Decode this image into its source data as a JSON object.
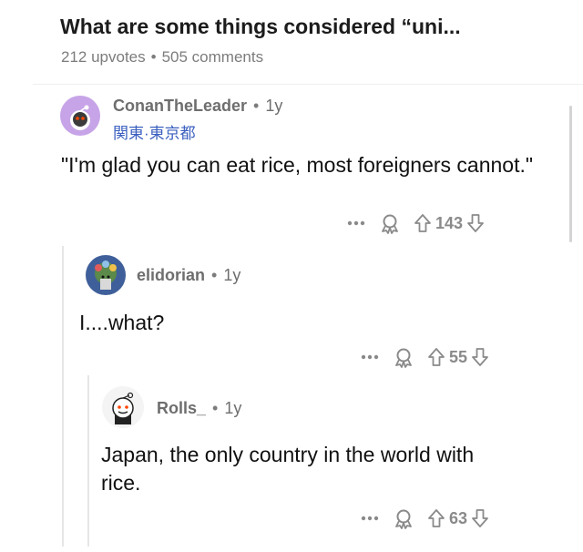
{
  "post": {
    "title": "What are some things considered “uni...",
    "upvotes": "212 upvotes",
    "separator": "•",
    "comments": "505 comments"
  },
  "comments": [
    {
      "author": "ConanTheLeader",
      "age": "1y",
      "flair": "関東·東京都",
      "body": "\"I'm glad you can eat rice, most foreigners cannot.\"",
      "votes": "143"
    },
    {
      "author": "elidorian",
      "age": "1y",
      "body": "I....what?",
      "votes": "55"
    },
    {
      "author": "Rolls_",
      "age": "1y",
      "body": "Japan, the only country in the world with rice.",
      "votes": "63"
    }
  ],
  "icons": {
    "more": "more-options-icon",
    "award": "award-icon",
    "upvote": "upvote-arrow-icon",
    "downvote": "downvote-arrow-icon"
  },
  "colors": {
    "flair": "#3a5fbf",
    "avatar1": "#c7a4e8",
    "muted": "#8a8a8a"
  }
}
